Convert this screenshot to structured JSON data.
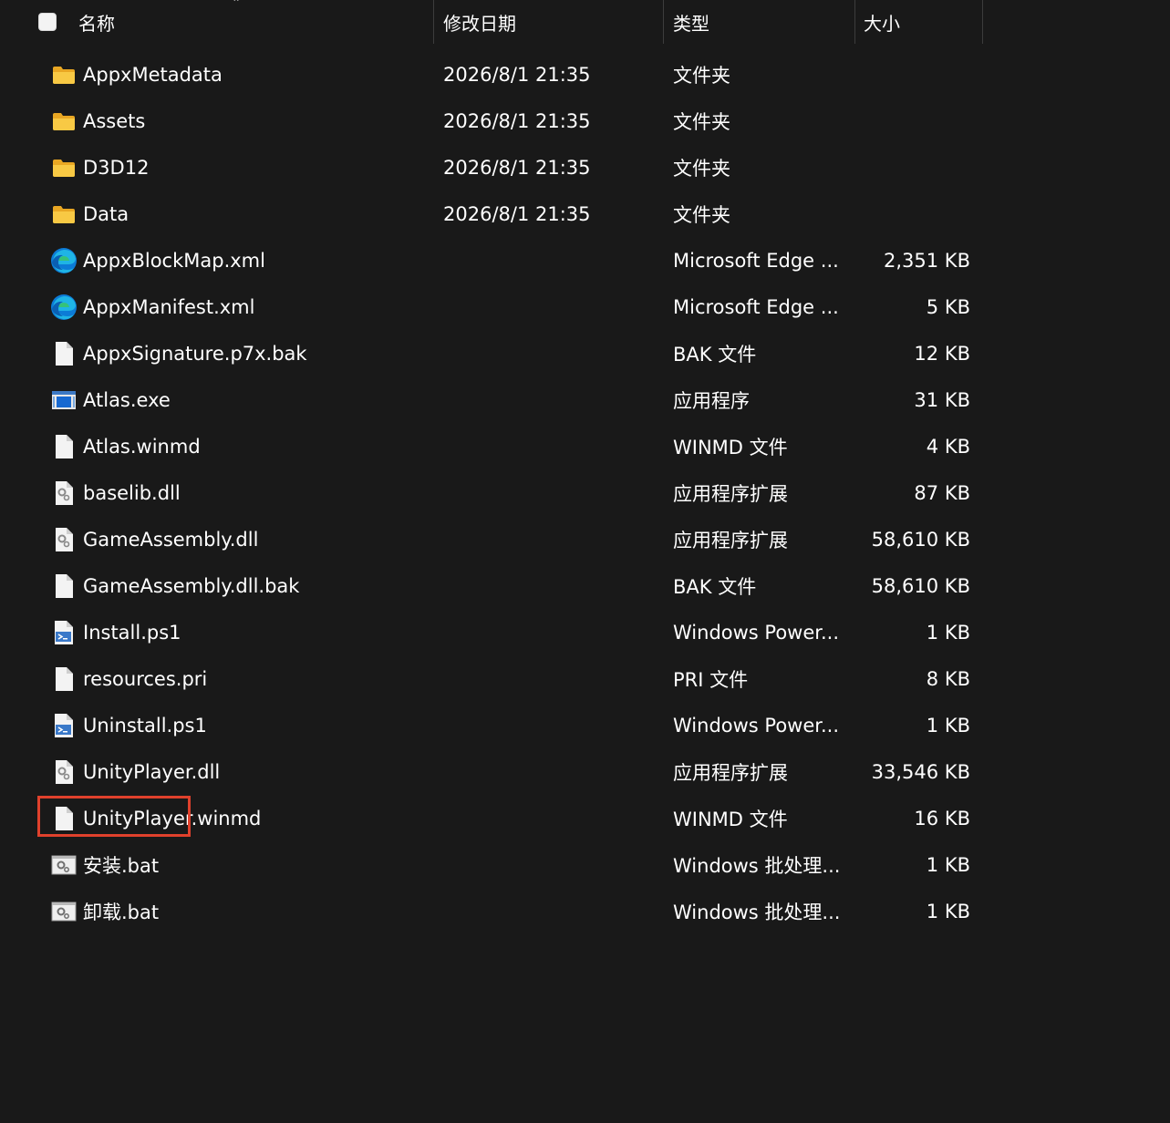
{
  "header": {
    "name": "名称",
    "date": "修改日期",
    "type": "类型",
    "size": "大小"
  },
  "files": [
    {
      "icon": "folder-icon",
      "name": "AppxMetadata",
      "date": "2026/8/1 21:35",
      "type": "文件夹",
      "size": ""
    },
    {
      "icon": "folder-icon",
      "name": "Assets",
      "date": "2026/8/1 21:35",
      "type": "文件夹",
      "size": ""
    },
    {
      "icon": "folder-icon",
      "name": "D3D12",
      "date": "2026/8/1 21:35",
      "type": "文件夹",
      "size": ""
    },
    {
      "icon": "folder-icon",
      "name": "Data",
      "date": "2026/8/1 21:35",
      "type": "文件夹",
      "size": ""
    },
    {
      "icon": "edge-icon",
      "name": "AppxBlockMap.xml",
      "date": "",
      "type": "Microsoft Edge ...",
      "size": "2,351 KB"
    },
    {
      "icon": "edge-icon",
      "name": "AppxManifest.xml",
      "date": "",
      "type": "Microsoft Edge ...",
      "size": "5 KB"
    },
    {
      "icon": "file-icon",
      "name": "AppxSignature.p7x.bak",
      "date": "",
      "type": "BAK 文件",
      "size": "12 KB"
    },
    {
      "icon": "exe-icon",
      "name": "Atlas.exe",
      "date": "",
      "type": "应用程序",
      "size": "31 KB"
    },
    {
      "icon": "file-icon",
      "name": "Atlas.winmd",
      "date": "",
      "type": "WINMD 文件",
      "size": "4 KB"
    },
    {
      "icon": "dll-icon",
      "name": "baselib.dll",
      "date": "",
      "type": "应用程序扩展",
      "size": "87 KB"
    },
    {
      "icon": "dll-icon",
      "name": "GameAssembly.dll",
      "date": "",
      "type": "应用程序扩展",
      "size": "58,610 KB"
    },
    {
      "icon": "file-icon",
      "name": "GameAssembly.dll.bak",
      "date": "",
      "type": "BAK 文件",
      "size": "58,610 KB"
    },
    {
      "icon": "powershell-icon",
      "name": "Install.ps1",
      "date": "",
      "type": "Windows Power...",
      "size": "1 KB"
    },
    {
      "icon": "file-icon",
      "name": "resources.pri",
      "date": "",
      "type": "PRI 文件",
      "size": "8 KB"
    },
    {
      "icon": "powershell-icon",
      "name": "Uninstall.ps1",
      "date": "",
      "type": "Windows Power...",
      "size": "1 KB"
    },
    {
      "icon": "dll-icon",
      "name": "UnityPlayer.dll",
      "date": "",
      "type": "应用程序扩展",
      "size": "33,546 KB"
    },
    {
      "icon": "file-icon",
      "name": "UnityPlayer.winmd",
      "date": "",
      "type": "WINMD 文件",
      "size": "16 KB"
    },
    {
      "icon": "bat-icon",
      "name": "安装.bat",
      "date": "",
      "type": "Windows 批处理...",
      "size": "1 KB"
    },
    {
      "icon": "bat-icon",
      "name": "卸载.bat",
      "date": "",
      "type": "Windows 批处理...",
      "size": "1 KB"
    }
  ],
  "colors": {
    "background": "#191919",
    "highlight_border": "#e0412c",
    "folder": "#f5c342"
  }
}
